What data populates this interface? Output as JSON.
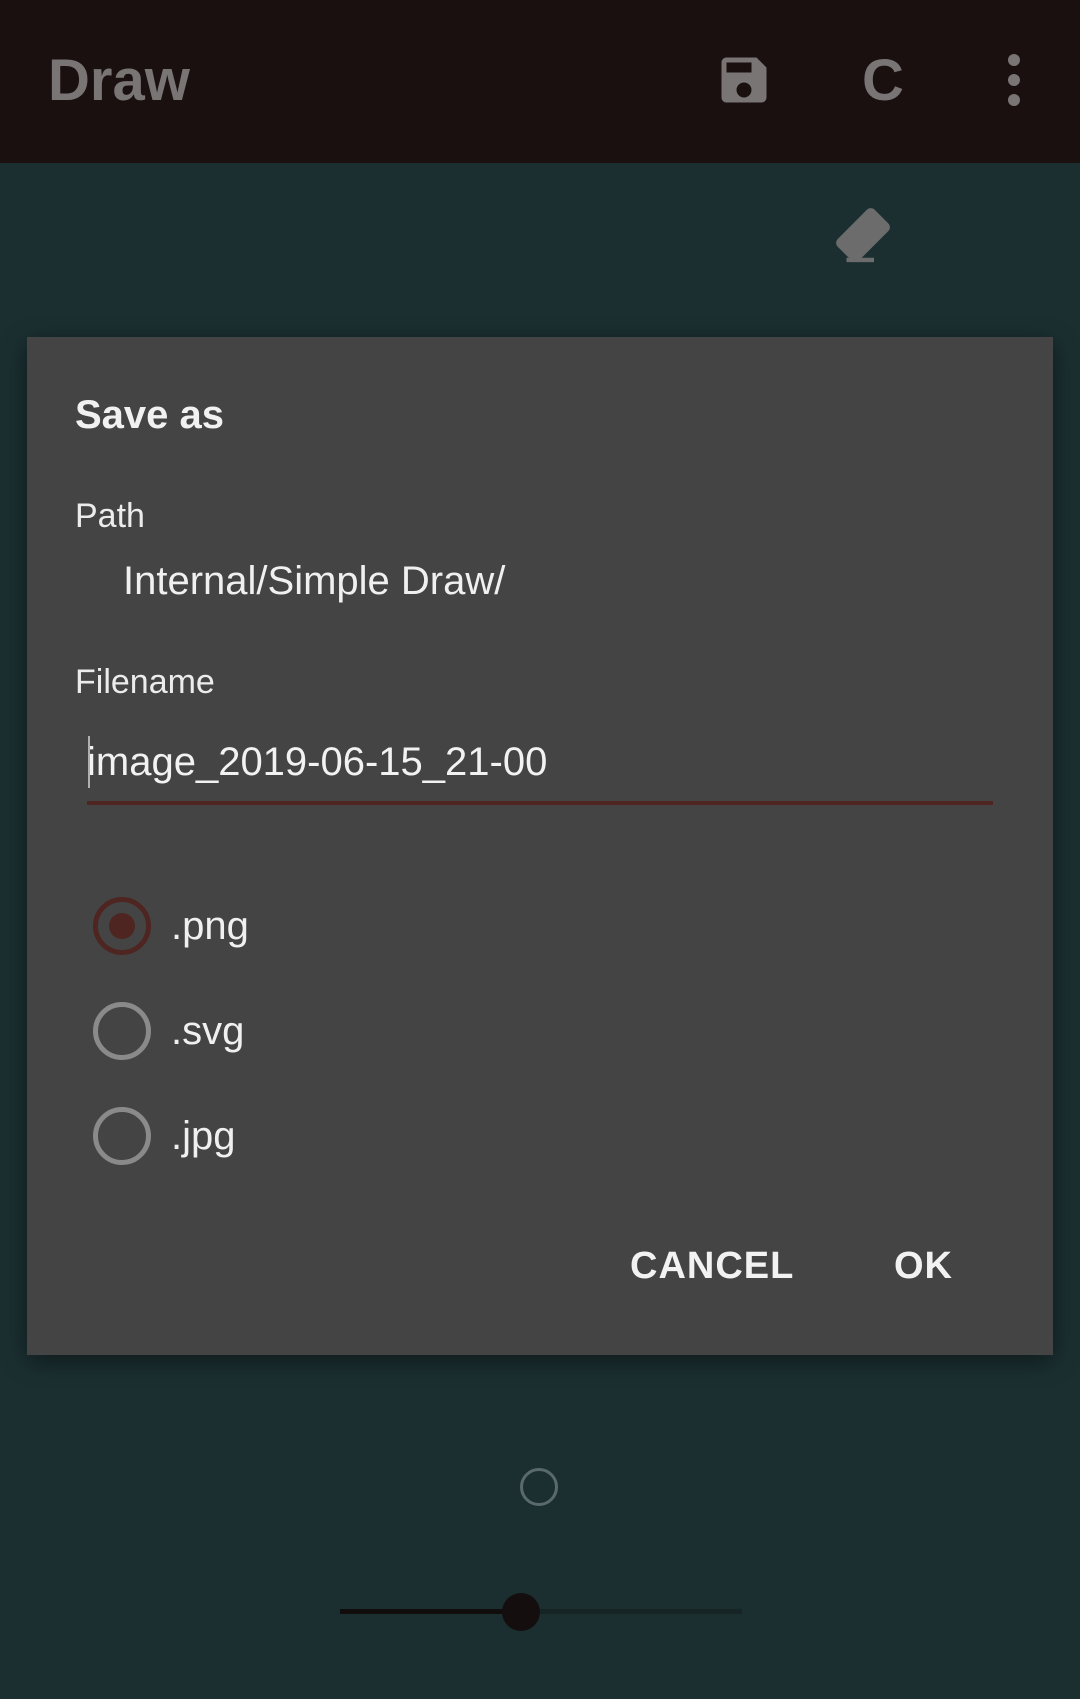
{
  "toolbar": {
    "title": "Draw",
    "save_icon": "save-icon",
    "clear_label": "C",
    "more_icon": "more-vert-icon"
  },
  "canvas": {
    "eraser_icon": "eraser-icon",
    "brush_size_fraction": 0.45
  },
  "dialog": {
    "title": "Save as",
    "path_label": "Path",
    "path_value": "Internal/Simple Draw/",
    "filename_label": "Filename",
    "filename_value": "image_2019-06-15_21-00",
    "formats": [
      {
        "label": ".png",
        "selected": true
      },
      {
        "label": ".svg",
        "selected": false
      },
      {
        "label": ".jpg",
        "selected": false
      }
    ],
    "cancel_label": "CANCEL",
    "ok_label": "OK"
  },
  "colors": {
    "toolbar_bg": "#1a1010",
    "canvas_bg": "#1b2f31",
    "dialog_bg": "#444444",
    "accent": "#4e2521"
  }
}
